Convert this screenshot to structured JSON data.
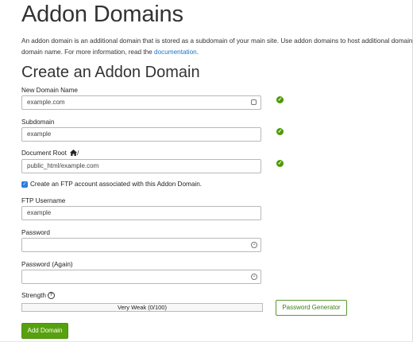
{
  "page": {
    "title": "Addon Domains",
    "intro_part1": "An addon domain is an additional domain that is stored as a subdomain of your main site. Use addon domains to host additional domains on yo",
    "intro_part2_prefix": "domain name. For more information, read the ",
    "intro_link": "documentation",
    "intro_part2_suffix": "."
  },
  "form": {
    "heading": "Create an Addon Domain",
    "new_domain": {
      "label": "New Domain Name",
      "value": "example.com"
    },
    "subdomain": {
      "label": "Subdomain",
      "value": "example"
    },
    "document_root": {
      "label": "Document Root",
      "label_suffix": "/",
      "value": "public_html/example.com"
    },
    "ftp_checkbox": {
      "label": "Create an FTP account associated with this Addon Domain.",
      "checked": true
    },
    "ftp_username": {
      "label": "FTP Username",
      "value": "example"
    },
    "password": {
      "label": "Password",
      "value": ""
    },
    "password_again": {
      "label": "Password (Again)",
      "value": ""
    },
    "strength": {
      "label": "Strength",
      "help_glyph": "?",
      "meter_text": "Very Weak (0/100)",
      "score": 0
    },
    "password_generator_label": "Password Generator",
    "submit_label": "Add Domain"
  },
  "icons": {
    "valid": "check-circle-icon",
    "home": "home-icon",
    "help": "help-icon",
    "autofill": "field-card-icon",
    "password_toggle": "password-reveal-icon"
  },
  "colors": {
    "accent_green": "#56a10d",
    "valid_green": "#4e9a06",
    "link_blue": "#1a73c9",
    "checkbox_blue": "#2d7be0"
  }
}
